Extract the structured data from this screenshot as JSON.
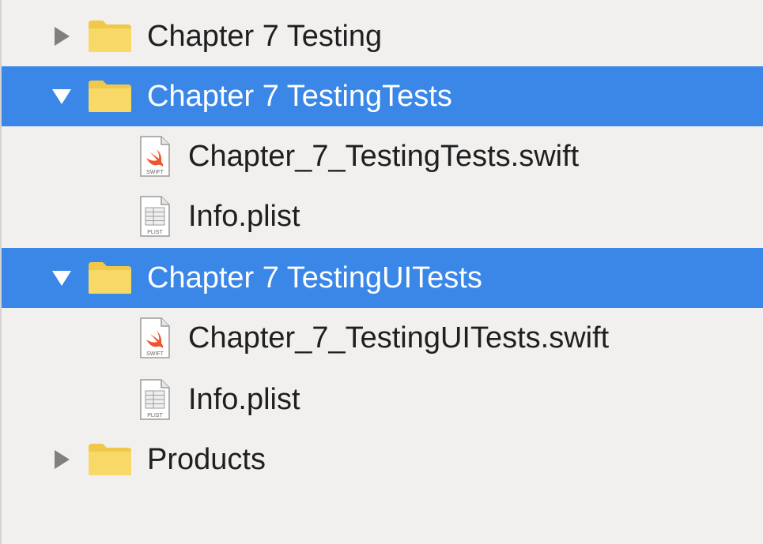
{
  "navigator": {
    "items": [
      {
        "kind": "folder",
        "label": "Chapter 7 Testing",
        "expanded": false,
        "selected": false,
        "icon": "folder-icon"
      },
      {
        "kind": "folder",
        "label": "Chapter 7 TestingTests",
        "expanded": true,
        "selected": true,
        "icon": "folder-icon"
      },
      {
        "kind": "file",
        "label": "Chapter_7_TestingTests.swift",
        "file_type": "SWIFT",
        "icon": "swift-file-icon"
      },
      {
        "kind": "file",
        "label": "Info.plist",
        "file_type": "PLIST",
        "icon": "plist-file-icon"
      },
      {
        "kind": "folder",
        "label": "Chapter 7 TestingUITests",
        "expanded": true,
        "selected": true,
        "icon": "folder-icon"
      },
      {
        "kind": "file",
        "label": "Chapter_7_TestingUITests.swift",
        "file_type": "SWIFT",
        "icon": "swift-file-icon"
      },
      {
        "kind": "file",
        "label": "Info.plist",
        "file_type": "PLIST",
        "icon": "plist-file-icon"
      },
      {
        "kind": "folder",
        "label": "Products",
        "expanded": false,
        "selected": false,
        "icon": "folder-icon"
      }
    ]
  },
  "colors": {
    "selection": "#3a87e8",
    "background": "#f2f0ef",
    "folder": "#f6cf55",
    "swift_orange": "#f0542e"
  }
}
